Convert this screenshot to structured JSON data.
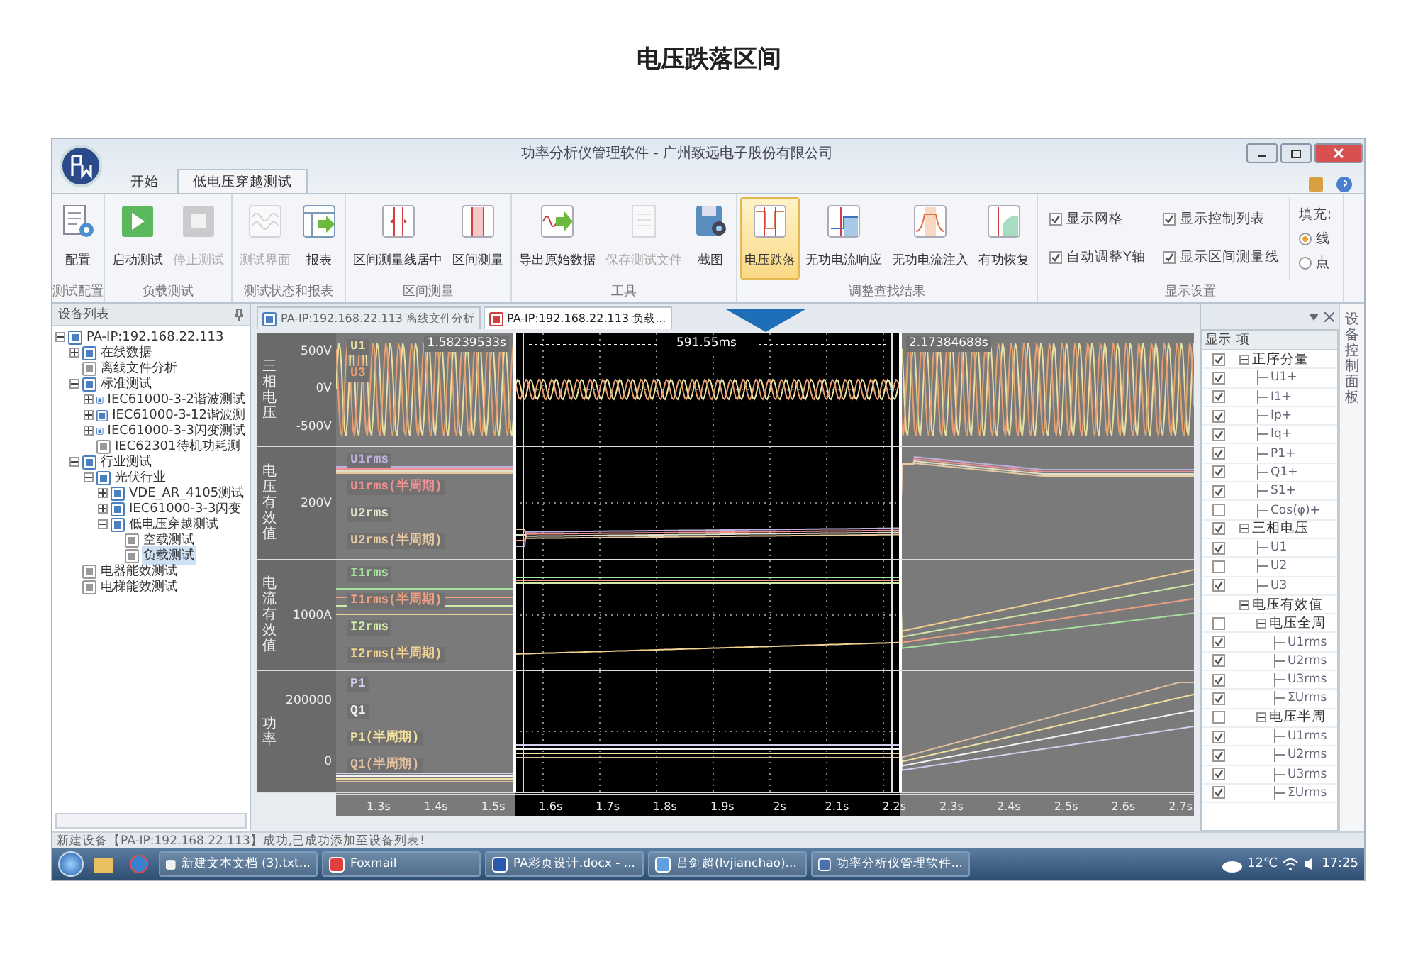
{
  "headline": "电压跌落区间",
  "window": {
    "title": "功率分析仪管理软件 - 广州致远电子股份有限公司"
  },
  "ribbon_tabs": [
    {
      "label": "开始",
      "selected": false
    },
    {
      "label": "低电压穿越测试",
      "selected": true
    }
  ],
  "ribbon_groups": [
    {
      "label": "测试配置",
      "items": [
        {
          "kind": "button",
          "label": "配置",
          "disabled": false,
          "selected": false
        }
      ]
    },
    {
      "label": "负载测试",
      "items": [
        {
          "kind": "button",
          "label": "启动测试",
          "disabled": false,
          "selected": false
        },
        {
          "kind": "button",
          "label": "停止测试",
          "disabled": true,
          "selected": false
        }
      ]
    },
    {
      "label": "测试状态和报表",
      "items": [
        {
          "kind": "button",
          "label": "测试界面",
          "disabled": true,
          "selected": false
        },
        {
          "kind": "button",
          "label": "报表",
          "disabled": false,
          "selected": false
        }
      ]
    },
    {
      "label": "区间测量",
      "items": [
        {
          "kind": "button",
          "label": "区间测量线居中",
          "disabled": false,
          "selected": false
        },
        {
          "kind": "button",
          "label": "区间测量",
          "disabled": false,
          "selected": false
        }
      ]
    },
    {
      "label": "工具",
      "items": [
        {
          "kind": "button",
          "label": "导出原始数据",
          "disabled": false,
          "selected": false
        },
        {
          "kind": "button",
          "label": "保存测试文件",
          "disabled": true,
          "selected": false
        },
        {
          "kind": "button",
          "label": "截图",
          "disabled": false,
          "selected": false
        }
      ]
    },
    {
      "label": "调整查找结果",
      "items": [
        {
          "kind": "button",
          "label": "电压跌落",
          "disabled": false,
          "selected": true
        },
        {
          "kind": "button",
          "label": "无功电流响应",
          "disabled": false,
          "selected": false
        },
        {
          "kind": "button",
          "label": "无功电流注入",
          "disabled": false,
          "selected": false
        },
        {
          "kind": "button",
          "label": "有功恢复",
          "disabled": false,
          "selected": false
        }
      ]
    },
    {
      "label": "显示设置",
      "items": [
        {
          "kind": "check",
          "label": "显示网格",
          "checked": true
        },
        {
          "kind": "check",
          "label": "自动调整Y轴",
          "checked": true
        },
        {
          "kind": "check",
          "label": "显示控制列表",
          "checked": true
        },
        {
          "kind": "check",
          "label": "显示区间测量线",
          "checked": true
        },
        {
          "kind": "radio_group",
          "label": "填充:",
          "options": [
            {
              "label": "线",
              "selected": true
            },
            {
              "label": "点",
              "selected": false
            }
          ]
        }
      ]
    }
  ],
  "device_panel": {
    "title": "设备列表"
  },
  "device_tree": [
    {
      "label": "PA-IP:192.168.22.113",
      "expanded": true,
      "selected": false,
      "children": [
        {
          "label": "在线数据",
          "expanded": false,
          "selected": false
        },
        {
          "label": "离线文件分析",
          "selected": false
        },
        {
          "label": "标准测试",
          "expanded": true,
          "selected": false,
          "children": [
            {
              "label": "IEC61000-3-2谐波测试",
              "expanded": false,
              "selected": false
            },
            {
              "label": "IEC61000-3-12谐波测",
              "expanded": false,
              "selected": false
            },
            {
              "label": "IEC61000-3-3闪变测试",
              "expanded": false,
              "selected": false
            },
            {
              "label": "IEC62301待机功耗测",
              "selected": false
            }
          ]
        },
        {
          "label": "行业测试",
          "expanded": true,
          "selected": false,
          "children": [
            {
              "label": "光伏行业",
              "expanded": true,
              "selected": false,
              "children": [
                {
                  "label": "VDE_AR_4105测试",
                  "expanded": false,
                  "selected": false
                },
                {
                  "label": "IEC61000-3-3闪变",
                  "expanded": false,
                  "selected": false
                },
                {
                  "label": "低电压穿越测试",
                  "expanded": true,
                  "selected": false,
                  "children": [
                    {
                      "label": "空载测试",
                      "selected": false
                    },
                    {
                      "label": "负载测试",
                      "selected": true
                    }
                  ]
                }
              ]
            }
          ]
        },
        {
          "label": "电器能效测试",
          "selected": false
        },
        {
          "label": "电梯能效测试",
          "selected": false
        }
      ]
    }
  ],
  "doc_tabs": [
    {
      "label": "PA-IP:192.168.22.113 离线文件分析",
      "selected": false
    },
    {
      "label": "PA-IP:192.168.22.113 负载...",
      "selected": true
    }
  ],
  "chart": {
    "strips": [
      {
        "kind": "wave",
        "title": "三相电压",
        "ticks": [
          "500V",
          "0V",
          "-500V"
        ],
        "series": [
          {
            "name": "U1",
            "color": "#e8e0a0"
          },
          {
            "name": "U3",
            "color": "#e8a070"
          }
        ]
      },
      {
        "kind": "drop",
        "title": "电压有效值",
        "ticks": [
          "200V"
        ],
        "series": [
          {
            "name": "U1rms",
            "color": "#c0b0e0"
          },
          {
            "name": "U1rms(半周期)",
            "color": "#f09090"
          },
          {
            "name": "U2rms",
            "color": "#e0e0c8"
          },
          {
            "name": "U2rms(半周期)",
            "color": "#e8c8a0"
          }
        ]
      },
      {
        "kind": "rise",
        "title": "电流有效值",
        "ticks": [
          "1000A"
        ],
        "series": [
          {
            "name": "I1rms",
            "color": "#a8e0a0"
          },
          {
            "name": "I1rms(半周期)",
            "color": "#f0a080"
          },
          {
            "name": "I2rms",
            "color": "#d0e8a8"
          },
          {
            "name": "I2rms(半周期)",
            "color": "#f0d090"
          }
        ]
      },
      {
        "kind": "power",
        "title": "功率",
        "ticks": [
          "200000",
          "0"
        ],
        "series": [
          {
            "name": "P1",
            "color": "#d0d0f0"
          },
          {
            "name": "Q1",
            "color": "#f4f4f4"
          },
          {
            "name": "P1(半周期)",
            "color": "#f0e0a0"
          },
          {
            "name": "Q1(半周期)",
            "color": "#e0c0a0"
          }
        ]
      }
    ],
    "x_ticks": [
      "1.3s",
      "1.4s",
      "1.5s",
      "1.6s",
      "1.7s",
      "1.8s",
      "1.9s",
      "2s",
      "2.1s",
      "2.2s",
      "2.3s",
      "2.4s",
      "2.5s",
      "2.6s",
      "2.7s"
    ],
    "cursor": {
      "start": "1.58239533s",
      "span": "591.55ms",
      "end": "2.17384688s"
    }
  },
  "control_list": {
    "columns": [
      "显示",
      "项"
    ],
    "rows": [
      {
        "label": "正序分量",
        "checked": true,
        "expanded": true,
        "children": [
          {
            "label": "U1+",
            "checked": true
          },
          {
            "label": "I1+",
            "checked": true
          },
          {
            "label": "Ip+",
            "checked": true
          },
          {
            "label": "Iq+",
            "checked": true
          },
          {
            "label": "P1+",
            "checked": true
          },
          {
            "label": "Q1+",
            "checked": true
          },
          {
            "label": "S1+",
            "checked": true
          },
          {
            "label": "Cos(φ)+",
            "checked": false
          }
        ]
      },
      {
        "label": "三相电压",
        "checked": true,
        "expanded": true,
        "children": [
          {
            "label": "U1",
            "checked": true
          },
          {
            "label": "U2",
            "checked": false
          },
          {
            "label": "U3",
            "checked": true
          }
        ]
      },
      {
        "label": "电压有效值",
        "expanded": true,
        "children": [
          {
            "label": "电压全周",
            "checked": false,
            "expanded": true,
            "children": [
              {
                "label": "U1rms",
                "checked": true
              },
              {
                "label": "U2rms",
                "checked": true
              },
              {
                "label": "U3rms",
                "checked": true
              },
              {
                "label": "ΣUrms",
                "checked": true
              }
            ]
          },
          {
            "label": "电压半周",
            "checked": false,
            "expanded": true,
            "children": [
              {
                "label": "U1rms",
                "checked": true
              },
              {
                "label": "U2rms",
                "checked": true
              },
              {
                "label": "U3rms",
                "checked": true
              },
              {
                "label": "ΣUrms",
                "checked": true
              }
            ]
          }
        ]
      }
    ]
  },
  "side_tab": {
    "label": "设备控制面板"
  },
  "status_bar": {
    "text": "新建设备【PA-IP:192.168.22.113】成功,已成功添加至设备列表!"
  },
  "taskbar": {
    "items": [
      {
        "label": "新建文本文档 (3).txt..."
      },
      {
        "label": "Foxmail"
      },
      {
        "label": "PA彩页设计.docx - ..."
      },
      {
        "label": "吕剑超(lvjianchao)..."
      },
      {
        "label": "功率分析仪管理软件..."
      }
    ],
    "weather": "12℃",
    "clock": "17:25"
  }
}
